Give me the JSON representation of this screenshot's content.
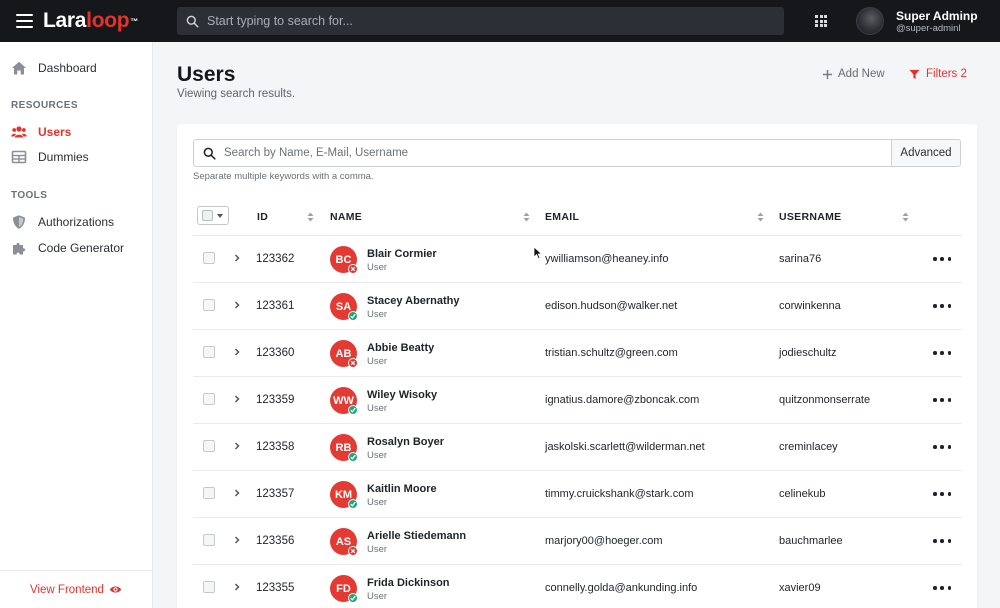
{
  "app": {
    "logo_prefix": "Lara",
    "logo_suffix": "loop",
    "logo_tm": "™",
    "search_placeholder": "Start typing to search for...",
    "user": {
      "name": "Super Adminp",
      "handle": "@super-adminl"
    }
  },
  "sidebar": {
    "dashboard": "Dashboard",
    "resources_heading": "RESOURCES",
    "users": "Users",
    "dummies": "Dummies",
    "tools_heading": "TOOLS",
    "authorizations": "Authorizations",
    "code_generator": "Code Generator",
    "footer": "View Frontend"
  },
  "page": {
    "title": "Users",
    "subtitle": "Viewing search results.",
    "add_new": "Add New",
    "filters": "Filters 2"
  },
  "search": {
    "placeholder": "Search by Name, E-Mail, Username",
    "advanced": "Advanced",
    "hint": "Separate multiple keywords with a comma."
  },
  "table": {
    "columns": {
      "id": "ID",
      "name": "NAME",
      "email": "EMAIL",
      "username": "USERNAME"
    },
    "rows": [
      {
        "id": "123362",
        "initials": "BC",
        "name": "Blair Cormier",
        "role": "User",
        "email": "ywilliamson@heaney.info",
        "username": "sarina76",
        "status": "inactive"
      },
      {
        "id": "123361",
        "initials": "SA",
        "name": "Stacey Abernathy",
        "role": "User",
        "email": "edison.hudson@walker.net",
        "username": "corwinkenna",
        "status": "active"
      },
      {
        "id": "123360",
        "initials": "AB",
        "name": "Abbie Beatty",
        "role": "User",
        "email": "tristian.schultz@green.com",
        "username": "jodieschultz",
        "status": "inactive"
      },
      {
        "id": "123359",
        "initials": "WW",
        "name": "Wiley Wisoky",
        "role": "User",
        "email": "ignatius.damore@zboncak.com",
        "username": "quitzonmonserrate",
        "status": "active"
      },
      {
        "id": "123358",
        "initials": "RB",
        "name": "Rosalyn Boyer",
        "role": "User",
        "email": "jaskolski.scarlett@wilderman.net",
        "username": "creminlacey",
        "status": "active"
      },
      {
        "id": "123357",
        "initials": "KM",
        "name": "Kaitlin Moore",
        "role": "User",
        "email": "timmy.cruickshank@stark.com",
        "username": "celinekub",
        "status": "active"
      },
      {
        "id": "123356",
        "initials": "AS",
        "name": "Arielle Stiedemann",
        "role": "User",
        "email": "marjory00@hoeger.com",
        "username": "bauchmarlee",
        "status": "inactive"
      },
      {
        "id": "123355",
        "initials": "FD",
        "name": "Frida Dickinson",
        "role": "User",
        "email": "connelly.golda@ankunding.info",
        "username": "xavier09",
        "status": "active"
      }
    ]
  },
  "colors": {
    "accent": "#e5322d",
    "avatar": "#e33b33",
    "status_active": "#1fa67a",
    "status_inactive": "#e5322d"
  }
}
